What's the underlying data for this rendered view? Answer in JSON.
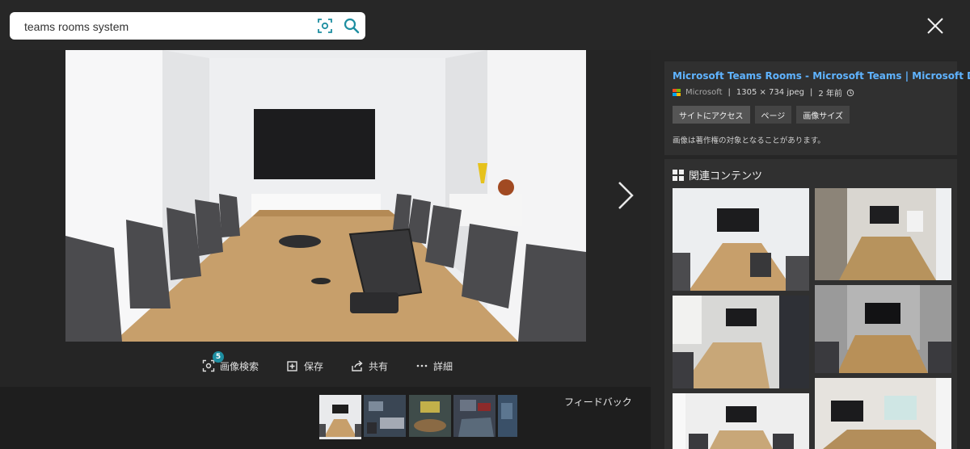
{
  "search": {
    "query": "teams rooms system",
    "visual_search_icon": "visual-search-icon",
    "search_icon": "search-icon"
  },
  "viewer": {
    "close_icon": "close-icon",
    "next_icon": "chevron-right-icon",
    "actions": [
      {
        "label": "画像検索",
        "icon": "visual-search-icon",
        "badge": "5"
      },
      {
        "label": "保存",
        "icon": "add-collection-icon"
      },
      {
        "label": "共有",
        "icon": "share-icon"
      },
      {
        "label": "詳細",
        "icon": "more-icon"
      }
    ],
    "feedback": "フィードバック"
  },
  "info": {
    "title": "Microsoft Teams Rooms - Microsoft Teams | Microsoft Docs",
    "source": "Microsoft",
    "dimensions": "1305 × 734 jpeg",
    "age": "2 年前",
    "separator": "|",
    "buttons": [
      "サイトにアクセス",
      "ページ",
      "画像サイズ"
    ],
    "copyright": "画像は著作権の対象となることがあります。"
  },
  "related": {
    "heading": "関連コンテンツ"
  },
  "colors": {
    "accent": "#1d8ea1",
    "link": "#5fb3ff",
    "background": "#272727",
    "panel": "#303030"
  }
}
